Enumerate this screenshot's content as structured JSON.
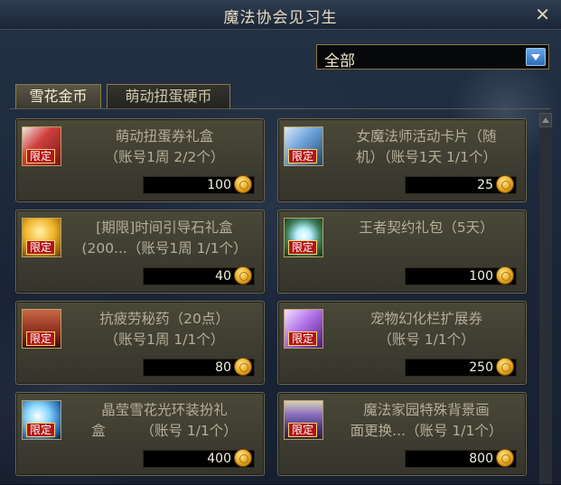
{
  "window": {
    "title": "魔法协会见习生",
    "close_label": "✕"
  },
  "filter": {
    "selected": "全部"
  },
  "tabs": [
    {
      "label": "雪花金币"
    },
    {
      "label": "萌动扭蛋硬币"
    }
  ],
  "items": [
    {
      "name": "萌动扭蛋券礼盒（账号1周 2/2个）",
      "badge": "限定",
      "price": "100",
      "icon": "red-gift-box-icon"
    },
    {
      "name": "女魔法师活动卡片（随机）（账号1天 1/1个）",
      "badge": "限定",
      "price": "25",
      "icon": "blue-card-icon"
    },
    {
      "name": "[期限]时间引导石礼盒(200...（账号1周 1/1个）",
      "badge": "限定",
      "price": "40",
      "icon": "gold-stone-box-icon"
    },
    {
      "name": "王者契约礼包（5天）",
      "badge": "限定",
      "price": "100",
      "icon": "contract-crystal-icon"
    },
    {
      "name": "抗疲劳秘药（20点）（账号1周 1/1个）",
      "badge": "限定",
      "price": "80",
      "icon": "potion-bottle-icon"
    },
    {
      "name": "宠物幻化栏扩展券（账号 1/1个）",
      "badge": "限定",
      "price": "250",
      "icon": "pet-ticket-icon"
    },
    {
      "name": "晶莹雪花光环装扮礼盒（账号 1/1个）",
      "badge": "限定",
      "price": "400",
      "icon": "snowflake-aura-icon"
    },
    {
      "name": "魔法家园特殊背景画面更换...（账号 1/1个）",
      "badge": "限定",
      "price": "800",
      "icon": "background-picture-icon"
    }
  ],
  "lines": {
    "i0a": "萌动扭蛋券礼盒",
    "i0b": "（账号1周 2/2个）",
    "i1a": "女魔法师活动卡片（随",
    "i1b": "机）（账号1天 1/1个）",
    "i2a": "[期限]时间引导石礼盒",
    "i2b": "(200...（账号1周 1/1个）",
    "i3a": "王者契约礼包（5天）",
    "i4a": "抗疲劳秘药（20点）",
    "i4b": "（账号1周 1/1个）",
    "i5a": "宠物幻化栏扩展券",
    "i5b": "（账号 1/1个）",
    "i6a": "晶莹雪花光环装扮礼",
    "i6b": "盒　　　（账号 1/1个）",
    "i7a": "魔法家园特殊背景画",
    "i7b": "面更换...（账号 1/1个）"
  },
  "colors": {
    "accent": "#f0d060",
    "badge": "#b11616",
    "card_border": "#6b6650"
  }
}
